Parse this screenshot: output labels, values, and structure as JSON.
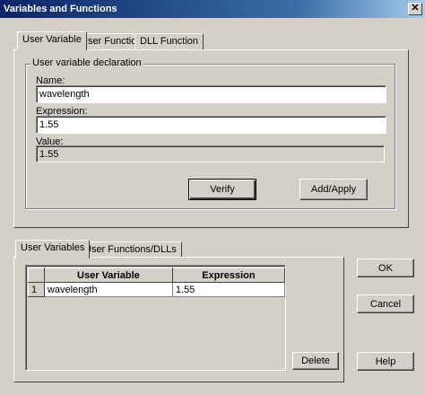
{
  "window": {
    "title": "Variables and Functions",
    "close_glyph": "✕"
  },
  "top_tabs": [
    "User Variable",
    "User Function",
    "DLL Function"
  ],
  "declaration": {
    "group_label": "User variable declaration",
    "name_label": "Name:",
    "name_value": "wavelength",
    "expression_label": "Expression:",
    "expression_value": "1.55",
    "value_label": "Value:",
    "value_value": "1.55",
    "verify_label": "Verify",
    "add_apply_label": "Add/Apply"
  },
  "bottom_tabs": [
    "User Variables",
    "User Functions/DLLs"
  ],
  "table": {
    "columns": [
      "User Variable",
      "Expression"
    ],
    "rows": [
      {
        "index": "1",
        "variable": "wavelength",
        "expression": "1.55"
      }
    ]
  },
  "buttons": {
    "delete": "Delete",
    "ok": "OK",
    "cancel": "Cancel",
    "help": "Help"
  }
}
